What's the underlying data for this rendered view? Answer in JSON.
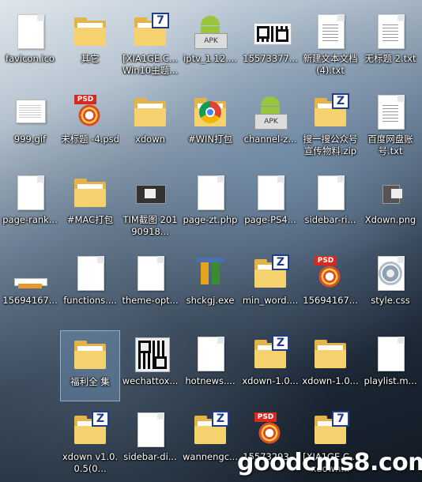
{
  "desktop": {
    "items": [
      {
        "label": "favicon.ico",
        "icon": "document-icon"
      },
      {
        "label": "其它",
        "icon": "folder-icon"
      },
      {
        "label": "[XIA1GE.C... Win10主题...",
        "icon": "folder-7zip-icon"
      },
      {
        "label": "iptv_1.12....",
        "icon": "apk-icon"
      },
      {
        "label": "15573377...",
        "icon": "qr-image-icon"
      },
      {
        "label": "新建文本文档 (4).txt",
        "icon": "text-file-icon"
      },
      {
        "label": "无标题 2.txt",
        "icon": "text-file-icon"
      },
      {
        "label": "999.gif",
        "icon": "gif-image-icon"
      },
      {
        "label": "未标题 -4.psd",
        "icon": "psd-icon"
      },
      {
        "label": "xdown",
        "icon": "folder-icon"
      },
      {
        "label": "#WIN打包",
        "icon": "folder-chrome-icon"
      },
      {
        "label": "channel-z...",
        "icon": "apk-icon"
      },
      {
        "label": "搜一搜公众号 宣传物料.zip",
        "icon": "zip-folder-icon"
      },
      {
        "label": "百度网盘账 号.txt",
        "icon": "text-file-icon"
      },
      {
        "label": "page-rank...",
        "icon": "document-icon"
      },
      {
        "label": "#MAC打包",
        "icon": "folder-icon"
      },
      {
        "label": "TIM截图 20190918...",
        "icon": "film-icon"
      },
      {
        "label": "page-zt.php",
        "icon": "document-icon"
      },
      {
        "label": "page-PS4...",
        "icon": "document-icon"
      },
      {
        "label": "sidebar-ri...",
        "icon": "document-icon"
      },
      {
        "label": "Xdown.png",
        "icon": "png-image-icon"
      },
      {
        "label": "15694167...",
        "icon": "banner-image-icon"
      },
      {
        "label": "functions....",
        "icon": "document-icon"
      },
      {
        "label": "theme-opt...",
        "icon": "document-icon"
      },
      {
        "label": "shckgj.exe",
        "icon": "swap-exe-icon"
      },
      {
        "label": "min_word....",
        "icon": "zip-folder-icon"
      },
      {
        "label": "15694167...",
        "icon": "psd-icon"
      },
      {
        "label": "style.css",
        "icon": "gear-document-icon"
      },
      {
        "label": "福利全 集",
        "icon": "folder-icon"
      },
      {
        "label": "wechattox...",
        "icon": "qr-image-icon"
      },
      {
        "label": "hotnews....",
        "icon": "document-icon"
      },
      {
        "label": "xdown-1.0...",
        "icon": "zip-folder-icon"
      },
      {
        "label": "xdown-1.0...",
        "icon": "folder-icon"
      },
      {
        "label": "playlist.m...",
        "icon": "document-icon"
      },
      {
        "label": "xdown v1.0.0.5(0...",
        "icon": "zip-folder-icon"
      },
      {
        "label": "sidebar-di...",
        "icon": "document-icon"
      },
      {
        "label": "wannengc...",
        "icon": "zip-folder-icon"
      },
      {
        "label": "15573293...",
        "icon": "psd-icon"
      },
      {
        "label": "[XIA1GE.C... xdown...",
        "icon": "folder-7zip-icon"
      }
    ],
    "selected_item": "福利全 集"
  },
  "watermark": {
    "text": "goodcms8.com"
  },
  "colors": {
    "folder": "#f6d26e",
    "folder_dark": "#e3b548",
    "badge": "#1f3d8a",
    "psd_red": "#d42a1f",
    "android": "#9ac43d"
  }
}
